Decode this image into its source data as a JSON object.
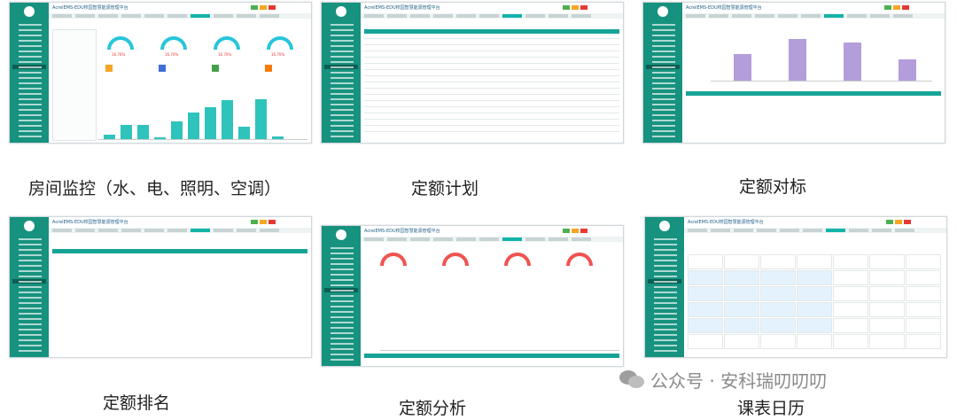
{
  "app_title": "AcrelEMS-EDU校园智慧能源管理平台",
  "panels": [
    {
      "caption": "房间监控（水、电、照明、空调）",
      "type": "room-monitor"
    },
    {
      "caption": "定额计划",
      "type": "quota-plan"
    },
    {
      "caption": "定额对标",
      "type": "quota-benchmark"
    },
    {
      "caption": "定额排名",
      "type": "quota-ranking"
    },
    {
      "caption": "定额分析",
      "type": "quota-analysis"
    },
    {
      "caption": "课表日历",
      "type": "timetable-calendar"
    }
  ],
  "gauges": {
    "value": "16.70%"
  },
  "watermark": {
    "text": "公众号 · 安科瑞叨叨叨"
  },
  "colors": {
    "sidebar": "#16927f",
    "accent": "#13b3a8",
    "bar_teal": "#2ec4bb",
    "bar_purple": "#b39ddb",
    "button_green": "#4caf50",
    "button_yellow": "#f5a623",
    "button_red": "#e53935"
  },
  "room_monitor_bars": [
    0.6,
    1.8,
    1.9,
    0.2,
    2.3,
    3.5,
    4.2,
    5.1,
    1.6,
    5.2,
    0.3,
    0
  ],
  "benchmark_bars": [
    3.2,
    5.0,
    4.6,
    2.5
  ]
}
